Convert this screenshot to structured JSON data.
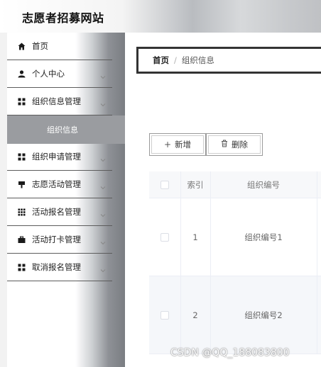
{
  "header": {
    "site_title": "志愿者招募网站"
  },
  "sidebar": {
    "items": [
      {
        "label": "首页",
        "icon": "home-icon",
        "has_chevron": false
      },
      {
        "label": "个人中心",
        "icon": "user-icon",
        "has_chevron": true
      },
      {
        "label": "组织信息管理",
        "icon": "grid-icon",
        "has_chevron": true
      },
      {
        "label": "组织申请管理",
        "icon": "grid-icon",
        "has_chevron": true
      },
      {
        "label": "志愿活动管理",
        "icon": "flag-icon",
        "has_chevron": true
      },
      {
        "label": "活动报名管理",
        "icon": "apps-icon",
        "has_chevron": true
      },
      {
        "label": "活动打卡管理",
        "icon": "briefcase-icon",
        "has_chevron": true
      },
      {
        "label": "取消报名管理",
        "icon": "grid-icon",
        "has_chevron": true
      }
    ],
    "active_submenu": {
      "label": "组织信息"
    }
  },
  "breadcrumb": {
    "home": "首页",
    "separator": "/",
    "current": "组织信息"
  },
  "toolbar": {
    "add_label": "新增",
    "delete_label": "删除"
  },
  "table": {
    "columns": [
      "索引",
      "组织编号"
    ],
    "rows": [
      {
        "index": "1",
        "org_code": "组织编号1"
      },
      {
        "index": "2",
        "org_code": "组织编号2"
      }
    ]
  },
  "watermark": "CSDN @QQ_188083800"
}
